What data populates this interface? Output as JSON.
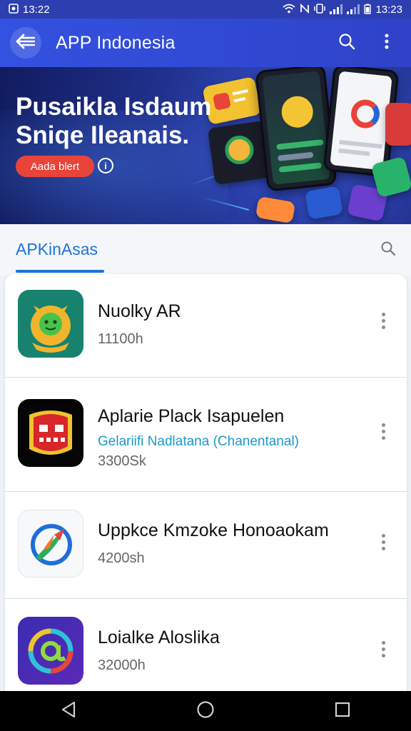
{
  "status_bar": {
    "left_time": "13:22",
    "right_time": "13:23",
    "icons": [
      "notification-icon",
      "wifi-icon",
      "nfc-icon",
      "vibrate-icon",
      "signal-icon",
      "battery-icon"
    ]
  },
  "app_bar": {
    "title": "APP Indonesia",
    "icons": [
      "back-arrow-icon",
      "search-icon",
      "more-vert-icon"
    ]
  },
  "banner": {
    "title": "Pusaikla Isdaum Sniqe Ileanais.",
    "button_label": "Aada blert",
    "info_glyph": "i"
  },
  "tabs": {
    "active_label": "APKinAsas"
  },
  "apps": [
    {
      "title": "Nuolky AR",
      "subtitle": "",
      "size": "11100h",
      "icon": "monster-face-icon"
    },
    {
      "title": "Aplarie Plack Isapuelen",
      "subtitle": "Gelariifi Nadlatana (Chanentanal)",
      "size": "3300Sk",
      "icon": "robot-face-icon"
    },
    {
      "title": "Uppkce Kmzoke Honoaokam",
      "subtitle": "",
      "size": "4200sh",
      "icon": "compass-arrow-icon"
    },
    {
      "title": "Loialke Aloslika",
      "subtitle": "",
      "size": "32000h",
      "icon": "at-sign-icon"
    }
  ],
  "colors": {
    "app_bar": "#3352e0",
    "accent": "#1e73d8",
    "banner_button": "#e8443a",
    "subtitle": "#1a9ac9"
  },
  "nav_bar": {
    "icons": [
      "back-triangle-icon",
      "home-circle-icon",
      "recents-square-icon"
    ]
  }
}
